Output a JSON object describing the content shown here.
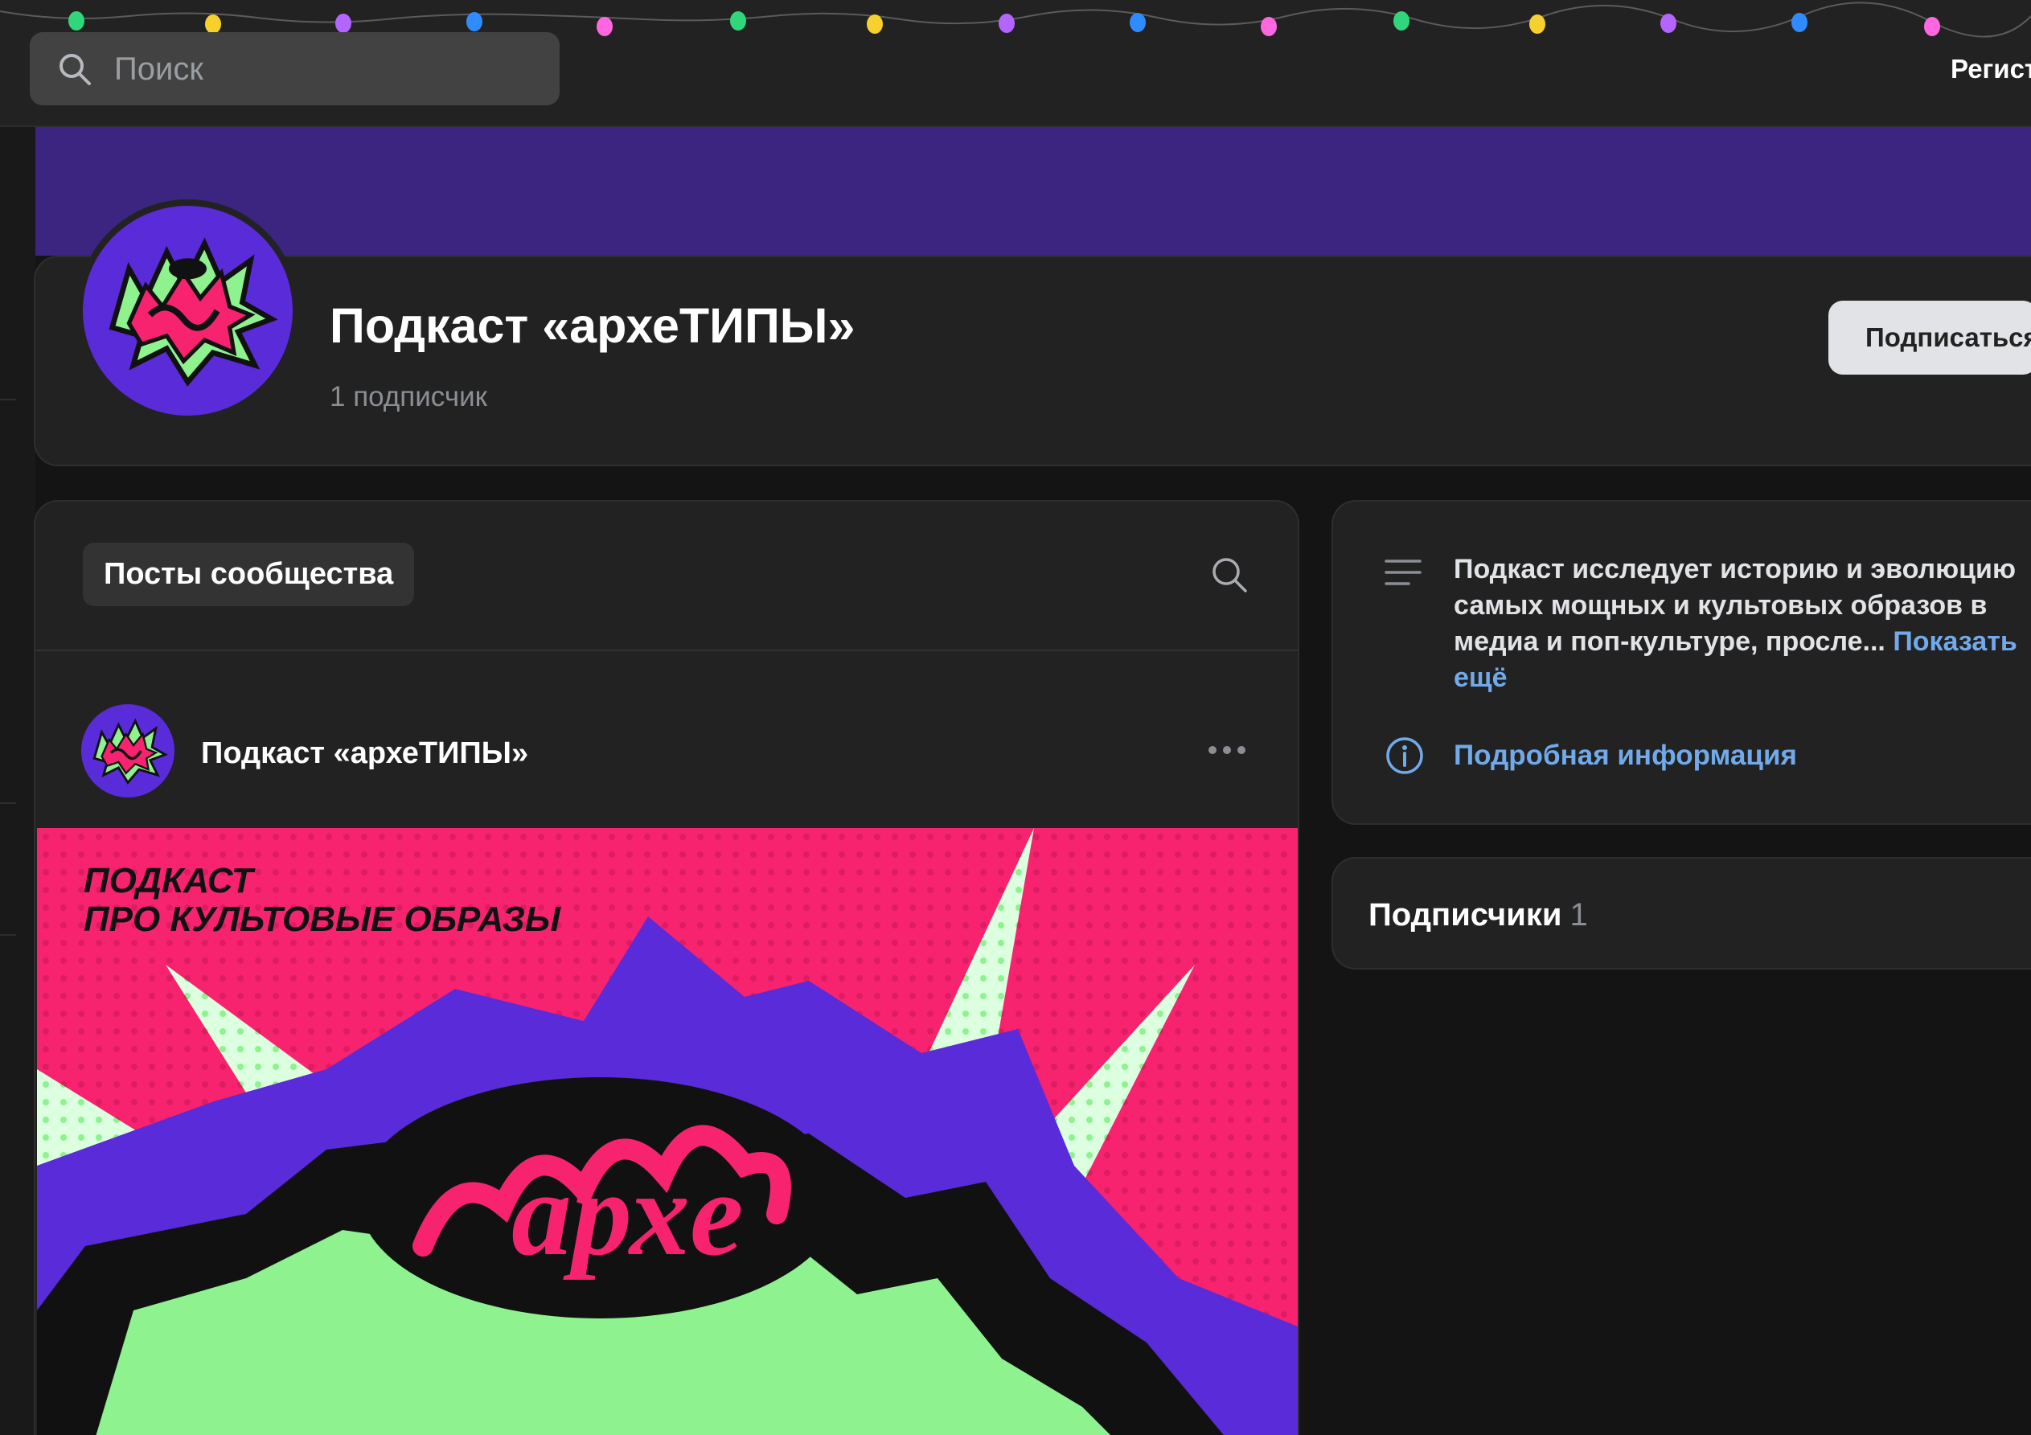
{
  "topbar": {
    "search_placeholder": "Поиск",
    "register_label": "Регист"
  },
  "group": {
    "title": "Подкаст «археТИПЫ»",
    "subscribers": "1 подписчик",
    "subscribe_label": "Подписаться",
    "cover_color": "#3c2481"
  },
  "posts": {
    "tab_label": "Посты сообщества",
    "author": "Подкаст «археТИПЫ»",
    "poster_text_line1": "ПОДКАСТ",
    "poster_text_line2": "ПРО КУЛЬТОВЫЕ ОБРАЗЫ",
    "poster_word": "архе"
  },
  "info": {
    "description": "Подкаст исследует историю и эволюцию самых мощных и культовых образов в медиа и поп-культуре, просле...",
    "show_more": "Показать ещё",
    "details_link": "Подробная информация"
  },
  "followers": {
    "label": "Подписчики",
    "count": "1"
  },
  "icons": {
    "search": "search-icon",
    "more": "more-dots-icon",
    "description": "text-lines-icon",
    "info": "info-circle-icon"
  },
  "colors": {
    "accent_link": "#71aaeb",
    "poster_pink": "#f8236f",
    "poster_purple": "#5a2bd8",
    "poster_green": "#8ef28f"
  }
}
